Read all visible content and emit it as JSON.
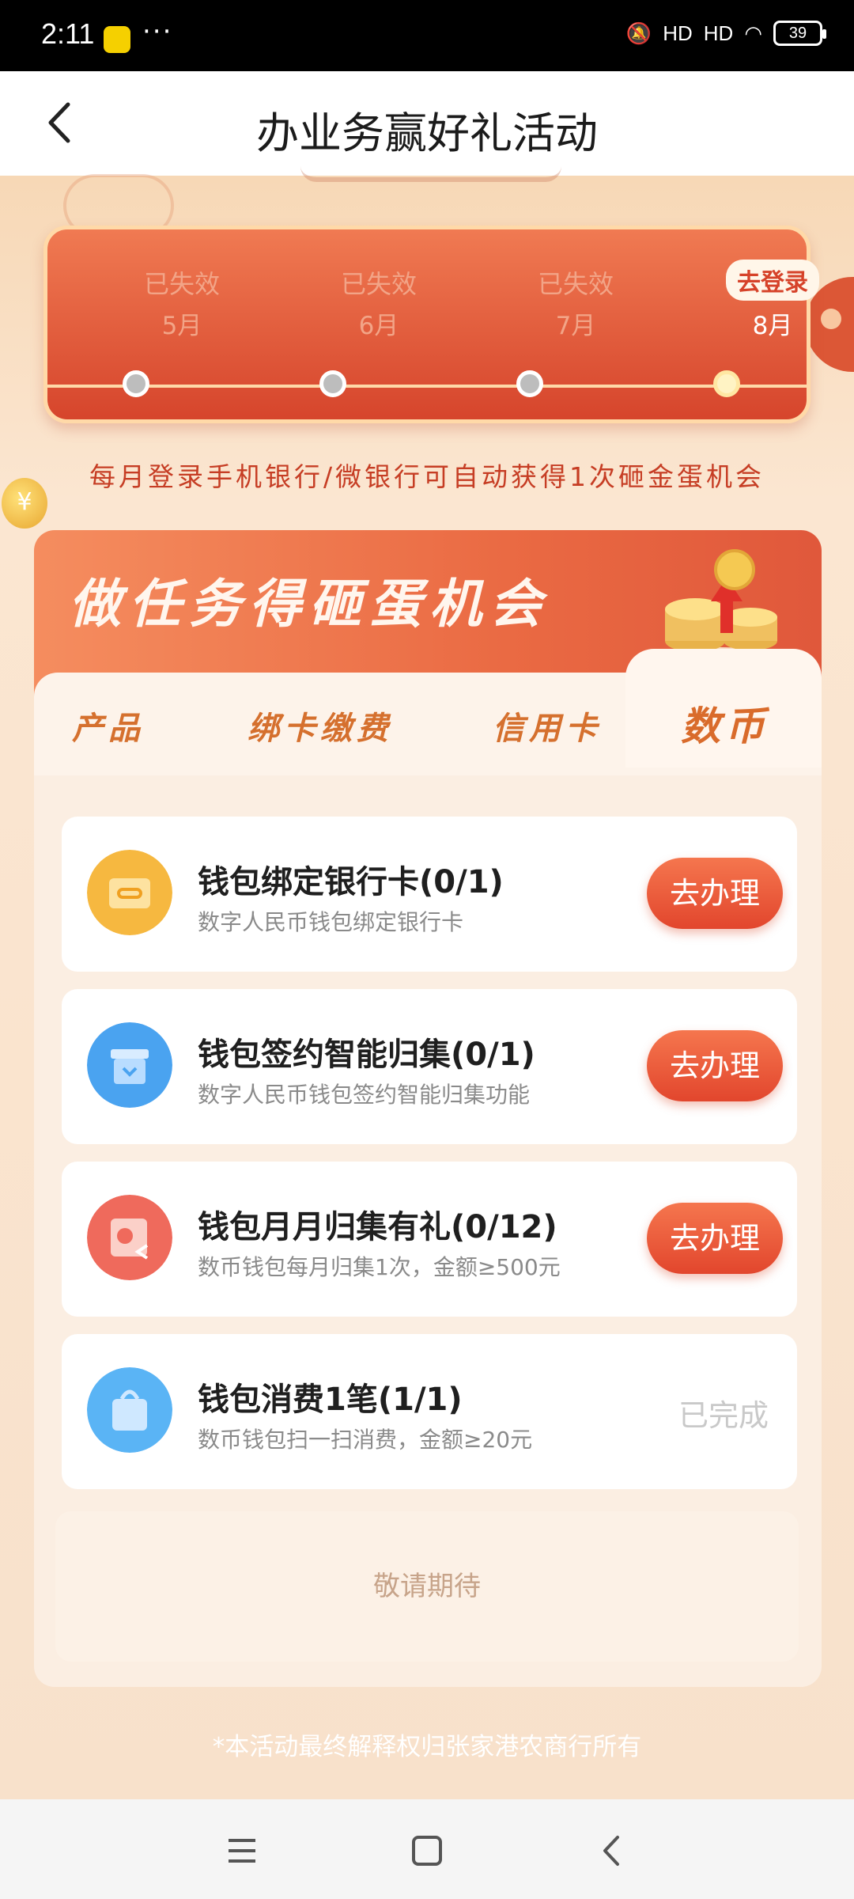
{
  "status_bar": {
    "time": "2:11",
    "dots": "···",
    "signal_1": "HD",
    "signal_2": "HD",
    "battery": "39"
  },
  "header": {
    "title": "办业务赢好礼活动"
  },
  "months": [
    {
      "status": "已失效",
      "label": "5月",
      "active": false
    },
    {
      "status": "已失效",
      "label": "6月",
      "active": false
    },
    {
      "status": "已失效",
      "label": "7月",
      "active": false
    },
    {
      "status": "去登录",
      "label": "8月",
      "active": true
    }
  ],
  "info_line": "每月登录手机银行/微银行可自动获得1次砸金蛋机会",
  "task_panel": {
    "title": "做任务得砸蛋机会",
    "tabs": [
      "产品",
      "绑卡缴费",
      "信用卡",
      "数币"
    ],
    "active_tab": "数币"
  },
  "tasks": [
    {
      "name": "钱包绑定银行卡(0/1)",
      "desc": "数字人民币钱包绑定银行卡",
      "action": "去办理",
      "icon": "link-card-icon",
      "color": "#f7b733"
    },
    {
      "name": "钱包签约智能归集(0/1)",
      "desc": "数字人民币钱包签约智能归集功能",
      "action": "去办理",
      "icon": "download-box-icon",
      "color": "#4aa3f0"
    },
    {
      "name": "钱包月月归集有礼(0/12)",
      "desc": "数币钱包每月归集1次，金额≥500元",
      "action": "去办理",
      "icon": "calendar-return-icon",
      "color": "#ef6a5c"
    },
    {
      "name": "钱包消费1笔(1/1)",
      "desc": "数币钱包扫一扫消费，金额≥20元",
      "action": "已完成",
      "icon": "shopping-bag-icon",
      "color": "#4aa3f0"
    }
  ],
  "coming_soon": "敬请期待",
  "footer_note": "*本活动最终解释权归张家港农商行所有",
  "nav": {
    "menu": "menu-icon",
    "home": "home-icon",
    "back": "back-icon"
  }
}
